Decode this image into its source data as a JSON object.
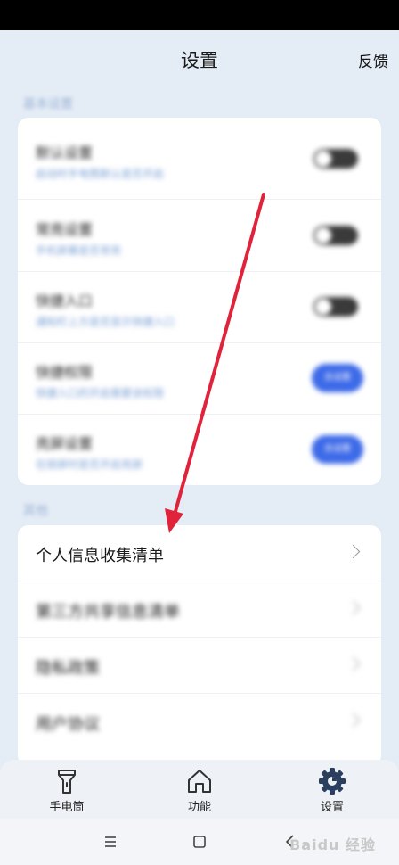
{
  "header": {
    "title": "设置",
    "feedback": "反馈"
  },
  "section_basic": {
    "label": "基本设置"
  },
  "basic_rows": [
    {
      "title": "默认设置",
      "sub": "启动时手电筒默认是否开启",
      "control": "toggle"
    },
    {
      "title": "常亮设置",
      "sub": "手机屏幕是否常亮",
      "control": "toggle"
    },
    {
      "title": "快捷入口",
      "sub": "通知栏上方是否显示快捷入口",
      "control": "toggle"
    },
    {
      "title": "快捷权限",
      "sub": "快捷入口的开启需要该权限",
      "control": "button",
      "button": "去设置"
    },
    {
      "title": "亮屏设置",
      "sub": "在锁屏时是否开启亮屏",
      "control": "button",
      "button": "去设置"
    }
  ],
  "section_other": {
    "label": "其他"
  },
  "other_rows": [
    {
      "label": "个人信息收集清单",
      "blurred": false
    },
    {
      "label": "第三方共享信息清单",
      "blurred": true
    },
    {
      "label": "隐私政策",
      "blurred": true
    },
    {
      "label": "用户协议",
      "blurred": true
    }
  ],
  "tabs": [
    {
      "label": "手电筒",
      "icon": "flashlight-icon"
    },
    {
      "label": "功能",
      "icon": "home-icon"
    },
    {
      "label": "设置",
      "icon": "gear-icon",
      "active": true
    }
  ],
  "watermark": "Baidu 经验",
  "colors": {
    "accent": "#3d6ae8",
    "annotation": "#e0223a",
    "background": "#e4ecf6"
  }
}
